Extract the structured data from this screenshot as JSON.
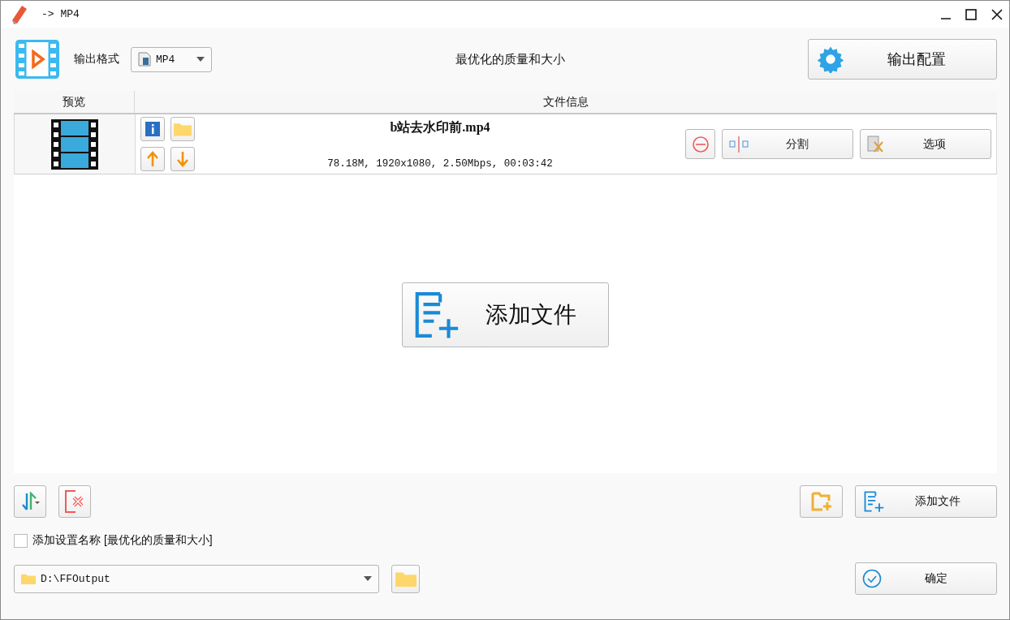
{
  "window": {
    "title": "-> MP4"
  },
  "toolbar": {
    "format_label": "输出格式",
    "format": "MP4",
    "profile": "最优化的质量和大小",
    "config_button": "输出配置"
  },
  "table": {
    "columns": [
      "预览",
      "文件信息"
    ],
    "rows": [
      {
        "name": "b站去水印前.mp4",
        "info": "78.18M, 1920x1080, 2.50Mbps, 00:03:42",
        "split_button": "分割",
        "options_button": "选项"
      }
    ]
  },
  "add_file_big": "添加文件",
  "add_file_button": "添加文件",
  "setting_name": {
    "label": "添加设置名称 [最优化的质量和大小]",
    "checked": false
  },
  "output_path": "D:\\FFOutput",
  "ok_button": "确定"
}
